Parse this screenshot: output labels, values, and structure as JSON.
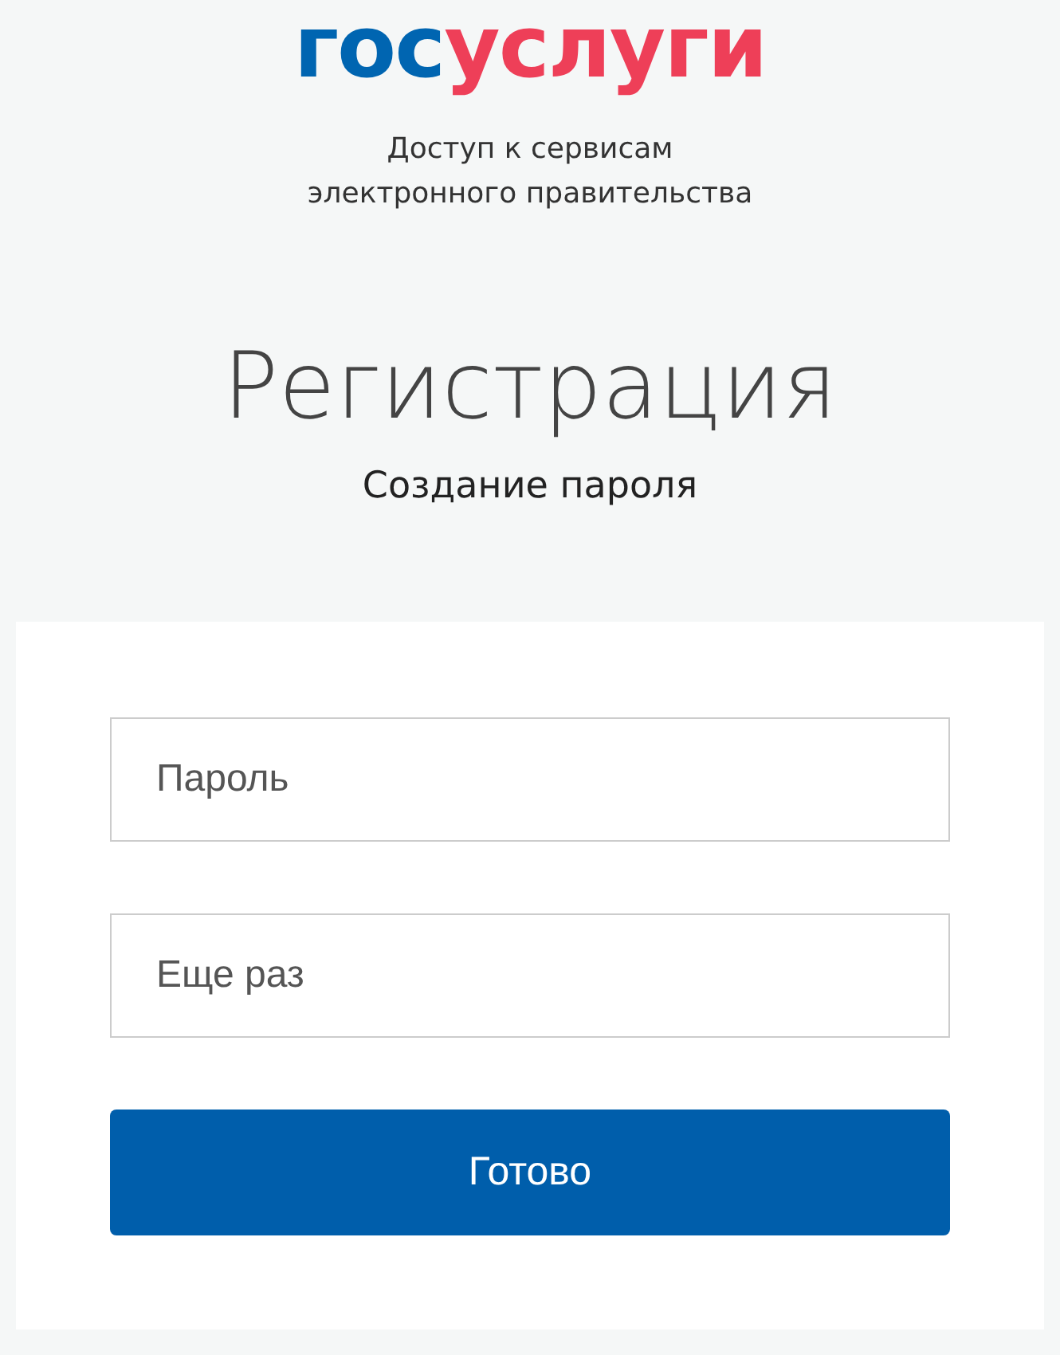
{
  "logo": {
    "parts": [
      {
        "text": "гос",
        "color": "#0065b1"
      },
      {
        "text": "услуги",
        "color": "#ee3f58"
      }
    ]
  },
  "tagline": "Доступ к сервисам электронного правительства",
  "title": "Регистрация",
  "subtitle": "Создание пароля",
  "form": {
    "fields": [
      {
        "placeholder": "Пароль"
      },
      {
        "placeholder": "Еще раз"
      }
    ],
    "submit": "Готово"
  }
}
